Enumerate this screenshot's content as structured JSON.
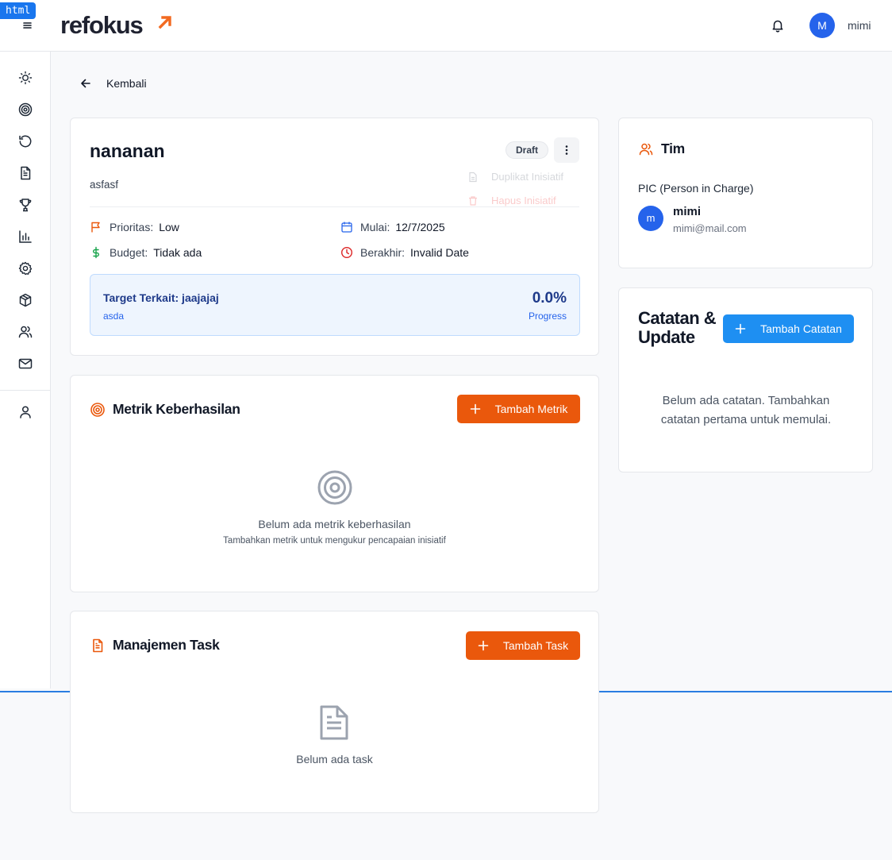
{
  "badge": "html",
  "header": {
    "logo": "refokus",
    "user_initial": "M",
    "username": "mimi"
  },
  "sidebar": {
    "items": [
      "sun-icon",
      "target-icon",
      "history-icon",
      "document-icon",
      "trophy-icon",
      "chart-icon",
      "settings-icon",
      "box-icon",
      "users-icon",
      "mail-icon",
      "user-icon"
    ]
  },
  "nav": {
    "back_label": "Kembali"
  },
  "initiative": {
    "title": "nananan",
    "description": "asfasf",
    "status": "Draft",
    "menu": {
      "duplicate": "Duplikat Inisiatif",
      "delete": "Hapus Inisiatif"
    },
    "priority_label": "Prioritas:",
    "priority": "Low",
    "budget_label": "Budget:",
    "budget": "Tidak ada",
    "start_label": "Mulai:",
    "start": "12/7/2025",
    "end_label": "Berakhir:",
    "end": "Invalid Date",
    "target": {
      "title": "Target Terkait: jaajajaj",
      "subtitle": "asda",
      "progress": "0.0%",
      "progress_label": "Progress"
    }
  },
  "metrics": {
    "title": "Metrik Keberhasilan",
    "add_label": "Tambah Metrik",
    "empty_title": "Belum ada metrik keberhasilan",
    "empty_sub": "Tambahkan metrik untuk mengukur pencapaian inisiatif"
  },
  "tasks": {
    "title": "Manajemen Task",
    "add_label": "Tambah Task",
    "empty_title": "Belum ada task"
  },
  "team": {
    "title": "Tim",
    "pic_label": "PIC (Person in Charge)",
    "pic_initial": "m",
    "pic_name": "mimi",
    "pic_email": "mimi@mail.com"
  },
  "notes": {
    "title": "Catatan & Update",
    "add_label": "Tambah Catatan",
    "empty": "Belum ada catatan. Tambahkan catatan pertama untuk memulai."
  },
  "colors": {
    "accent_orange": "#ea580c",
    "accent_blue": "#1e8ff2",
    "avatar_blue": "#2563eb"
  }
}
